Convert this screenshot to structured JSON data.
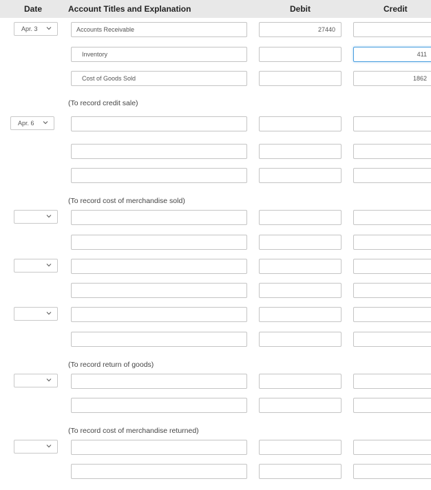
{
  "header": {
    "date": "Date",
    "account": "Account Titles and Explanation",
    "debit": "Debit",
    "credit": "Credit"
  },
  "entries": [
    {
      "date": "Apr. 3",
      "rows": [
        {
          "account": "Accounts Receivable",
          "debit": "27440",
          "credit": ""
        },
        {
          "account": "Inventory",
          "debit": "",
          "credit": "411"
        },
        {
          "account": "Cost of Goods Sold",
          "debit": "",
          "credit": "1862"
        }
      ],
      "note": "(To record credit sale)"
    },
    {
      "date": "Apr. 6",
      "rows": [
        {
          "account": "",
          "debit": "",
          "credit": ""
        },
        {
          "account": "",
          "debit": "",
          "credit": ""
        },
        {
          "account": "",
          "debit": "",
          "credit": ""
        }
      ],
      "note": "(To record cost of merchandise sold)"
    },
    {
      "date": "",
      "rows": [
        {
          "account": "",
          "debit": "",
          "credit": ""
        },
        {
          "account": "",
          "debit": "",
          "credit": ""
        }
      ]
    },
    {
      "date": "",
      "rows": [
        {
          "account": "",
          "debit": "",
          "credit": ""
        },
        {
          "account": "",
          "debit": "",
          "credit": ""
        }
      ]
    },
    {
      "date": "",
      "rows": [
        {
          "account": "",
          "debit": "",
          "credit": ""
        },
        {
          "account": "",
          "debit": "",
          "credit": ""
        }
      ],
      "note": "(To record return of goods)"
    },
    {
      "date": "",
      "rows": [
        {
          "account": "",
          "debit": "",
          "credit": ""
        },
        {
          "account": "",
          "debit": "",
          "credit": ""
        }
      ],
      "note": "(To record cost of merchandise returned)"
    },
    {
      "date": "",
      "rows": [
        {
          "account": "",
          "debit": "",
          "credit": ""
        },
        {
          "account": "",
          "debit": "",
          "credit": ""
        }
      ]
    }
  ],
  "focused_field": "credit-row-2",
  "colors": {
    "header_bg": "#e8e8e8",
    "focus_border": "#4a9fe0",
    "input_border": "#c4c4c4"
  }
}
